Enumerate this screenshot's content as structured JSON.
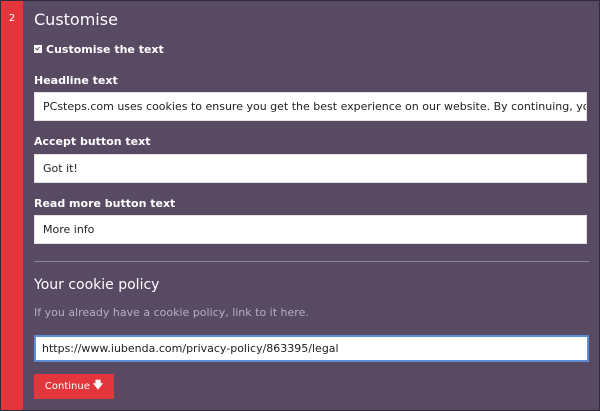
{
  "step": {
    "number": "2"
  },
  "section": {
    "title": "Customise"
  },
  "customise_checkbox": {
    "label": "Customise the text",
    "checked": true
  },
  "fields": {
    "headline": {
      "label": "Headline text",
      "value": "PCsteps.com uses cookies to ensure you get the best experience on our website. By continuing, you consent"
    },
    "accept": {
      "label": "Accept button text",
      "value": "Got it!"
    },
    "read_more": {
      "label": "Read more button text",
      "value": "More info"
    }
  },
  "cookie_policy": {
    "title": "Your cookie policy",
    "helper": "If you already have a cookie policy, link to it here.",
    "url": "https://www.iubenda.com/privacy-policy/863395/legal"
  },
  "continue_button": {
    "label": "Continue",
    "icon": "arrow-down-icon"
  },
  "colors": {
    "panel_background": "#584a63",
    "accent_red": "#e2363c",
    "focus_border": "#5b8ed6"
  }
}
